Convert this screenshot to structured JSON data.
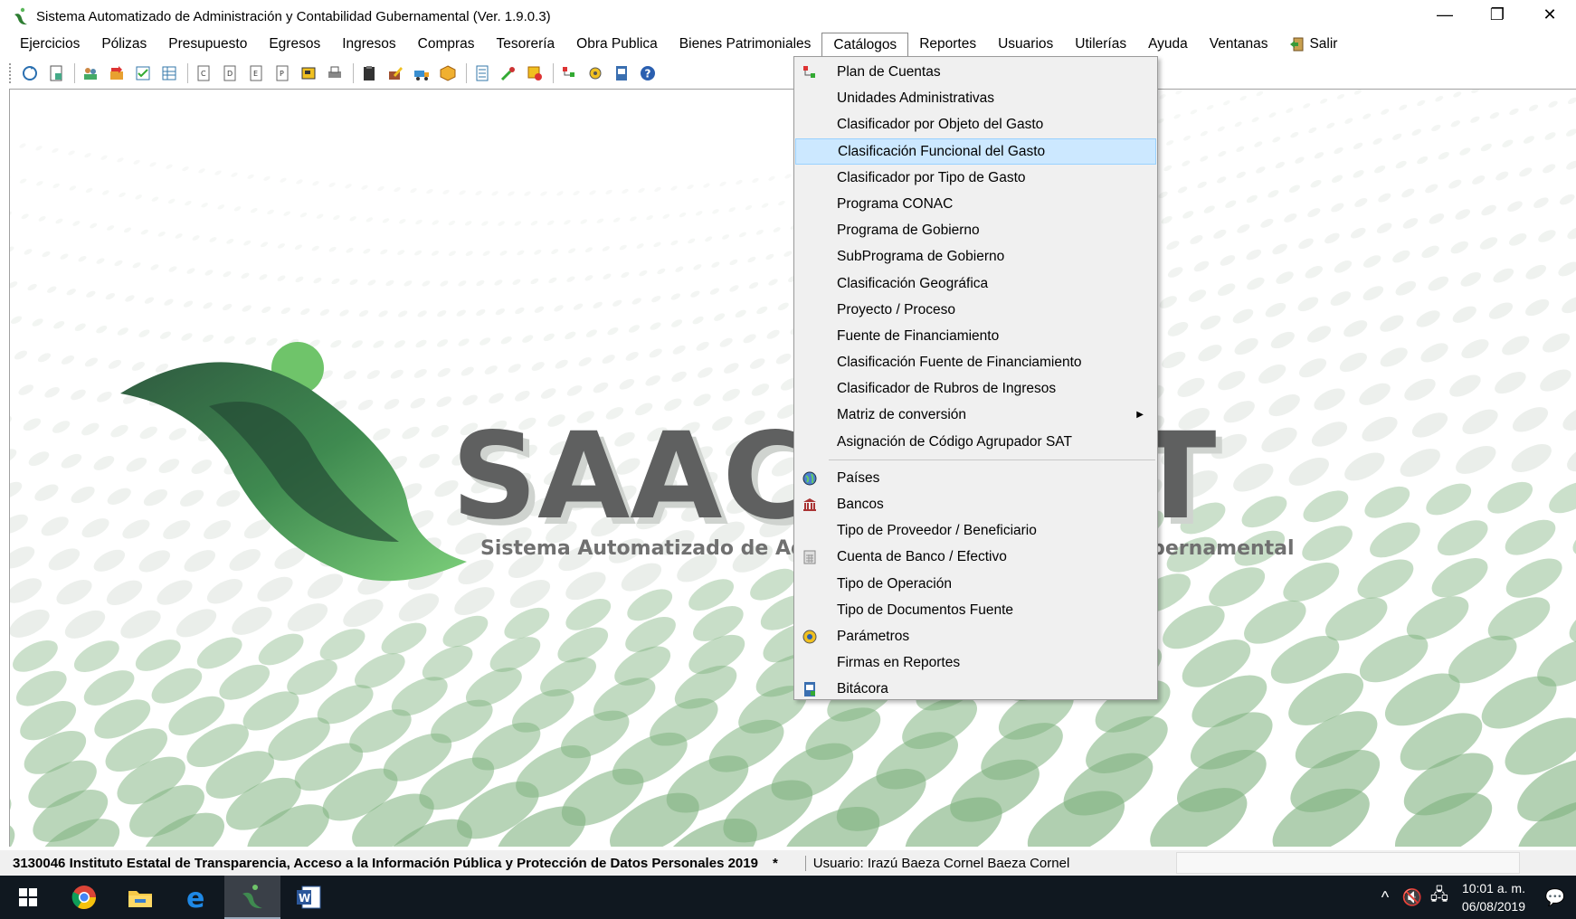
{
  "window": {
    "title": "Sistema Automatizado de Administración y Contabilidad Gubernamental  (Ver. 1.9.0.3)",
    "minimize": "—",
    "restore": "❐",
    "close": "✕"
  },
  "menubar": [
    {
      "label": "Ejercicios"
    },
    {
      "label": "Pólizas"
    },
    {
      "label": "Presupuesto"
    },
    {
      "label": "Egresos"
    },
    {
      "label": "Ingresos"
    },
    {
      "label": "Compras"
    },
    {
      "label": "Tesorería"
    },
    {
      "label": "Obra Publica"
    },
    {
      "label": "Bienes Patrimoniales"
    },
    {
      "label": "Catálogos"
    },
    {
      "label": "Reportes"
    },
    {
      "label": "Usuarios"
    },
    {
      "label": "Utilerías"
    },
    {
      "label": "Ayuda"
    },
    {
      "label": "Ventanas"
    },
    {
      "label": "Salir"
    }
  ],
  "catalogos_menu": [
    {
      "label": "Plan de Cuentas"
    },
    {
      "label": "Unidades Administrativas"
    },
    {
      "label": "Clasificador por Objeto del Gasto"
    },
    {
      "label": "Clasificación Funcional del Gasto"
    },
    {
      "label": "Clasificador por Tipo de Gasto"
    },
    {
      "label": "Programa CONAC"
    },
    {
      "label": "Programa de Gobierno"
    },
    {
      "label": "SubPrograma de Gobierno"
    },
    {
      "label": "Clasificación Geográfica"
    },
    {
      "label": "Proyecto / Proceso"
    },
    {
      "label": "Fuente de Financiamiento"
    },
    {
      "label": "Clasificación Fuente de Financiamiento"
    },
    {
      "label": "Clasificador de Rubros de Ingresos"
    },
    {
      "label": "Matriz de conversión"
    },
    {
      "label": "Asignación de Código Agrupador SAT"
    },
    {
      "label": "Países"
    },
    {
      "label": "Bancos"
    },
    {
      "label": "Tipo de Proveedor / Beneficiario"
    },
    {
      "label": "Cuenta de Banco / Efectivo"
    },
    {
      "label": "Tipo de Operación"
    },
    {
      "label": "Tipo de Documentos Fuente"
    },
    {
      "label": "Parámetros"
    },
    {
      "label": "Firmas en Reportes"
    },
    {
      "label": "Bitácora"
    }
  ],
  "background": {
    "logo_text": "SAACG.NET",
    "logo_subtitle": "Sistema Automatizado de Administración y Contabilidad Gubernamental",
    "brand_green": "#4caf50",
    "brand_gray": "#5a5a5a"
  },
  "statusbar": {
    "company": "3130046 Instituto Estatal de Transparencia, Acceso a la Información Pública y Protección de Datos Personales  2019",
    "flag": "*",
    "user": "Usuario: Irazú Baeza Cornel Baeza Cornel"
  },
  "taskbar": {
    "time": "10:01 a. m.",
    "date": "06/08/2019"
  }
}
